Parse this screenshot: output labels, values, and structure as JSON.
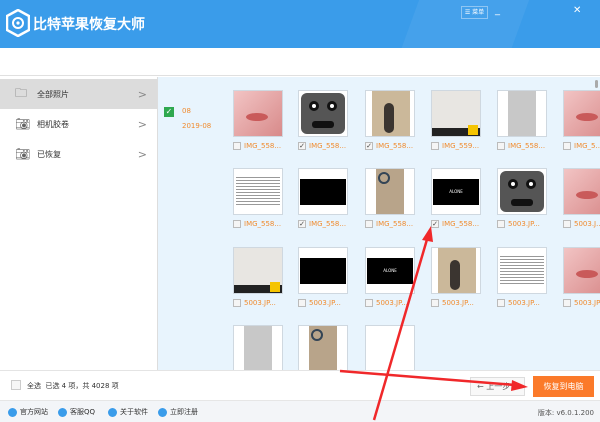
{
  "app": {
    "title": "比特苹果恢复大师",
    "menu_label": "菜单",
    "minimize": "_",
    "close": "✕"
  },
  "sidebar": {
    "items": [
      {
        "label": "全部照片",
        "icon": "folder-icon"
      },
      {
        "label": "相机胶卷",
        "icon": "camera-icon"
      },
      {
        "label": "已恢复",
        "icon": "camera-icon"
      }
    ]
  },
  "group": {
    "day": "08",
    "month": "2019-08",
    "checked": true
  },
  "photos": [
    {
      "label": "IMG_558...",
      "checked": false,
      "kind": "lips"
    },
    {
      "label": "IMG_558...",
      "checked": true,
      "kind": "face"
    },
    {
      "label": "IMG_558...",
      "checked": true,
      "kind": "shadow"
    },
    {
      "label": "IMG_559...",
      "checked": false,
      "kind": "shoes"
    },
    {
      "label": "IMG_558...",
      "checked": false,
      "kind": "gray"
    },
    {
      "label": "IMG_5...",
      "checked": false,
      "kind": "lips"
    },
    {
      "label": "IMG_558...",
      "checked": false,
      "kind": "text"
    },
    {
      "label": "IMG_558...",
      "checked": true,
      "kind": "black"
    },
    {
      "label": "IMG_558...",
      "checked": false,
      "kind": "ring"
    },
    {
      "label": "IMG_558...",
      "checked": true,
      "kind": "alone"
    },
    {
      "label": "5003.JP...",
      "checked": false,
      "kind": "face"
    },
    {
      "label": "5003.J...",
      "checked": false,
      "kind": "lips"
    },
    {
      "label": "5003.JP...",
      "checked": false,
      "kind": "shoes"
    },
    {
      "label": "5003.JP...",
      "checked": false,
      "kind": "black"
    },
    {
      "label": "5003.JP...",
      "checked": false,
      "kind": "alone"
    },
    {
      "label": "5003.JP...",
      "checked": false,
      "kind": "shadow"
    },
    {
      "label": "5003.JP...",
      "checked": false,
      "kind": "text"
    },
    {
      "label": "5003.JP...",
      "checked": false,
      "kind": "lips"
    },
    {
      "label": "",
      "checked": false,
      "kind": "gray"
    },
    {
      "label": "",
      "checked": false,
      "kind": "ring"
    },
    {
      "label": "",
      "checked": false,
      "kind": "blank"
    }
  ],
  "bottom": {
    "select_all": "全选",
    "summary": "已选 4 项，共 4028 项",
    "prev": "← 上一步",
    "recover": "恢复到电脑"
  },
  "footer": {
    "links": [
      "官方网站",
      "客服QQ",
      "关于软件",
      "立即注册"
    ],
    "version": "版本: v6.0.1.200"
  }
}
